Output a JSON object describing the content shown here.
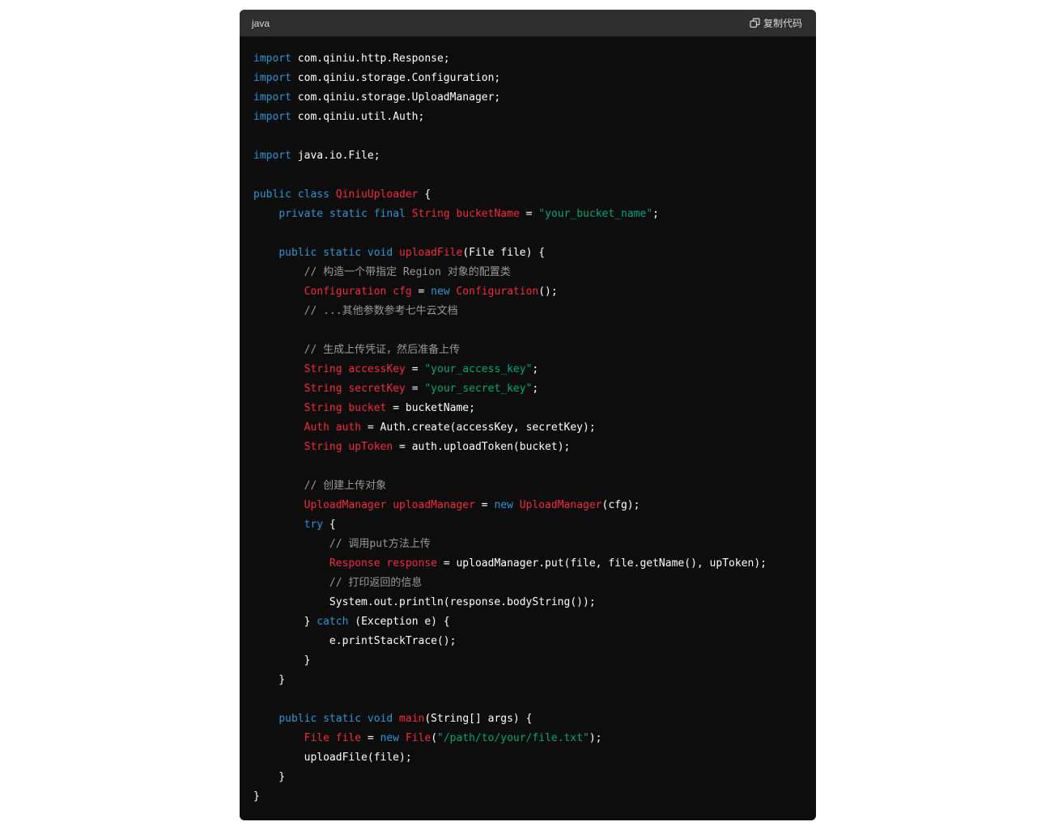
{
  "header": {
    "language": "java",
    "copy_label": "复制代码",
    "copy_icon": "copy-icon"
  },
  "colors": {
    "background": "#0d0d0d",
    "header_background": "#2f2f2f",
    "keyword": "#2e95d3",
    "type": "#f22c3d",
    "string": "#00a67d",
    "comment": "#9a9a9a",
    "plain": "#ffffff"
  },
  "code_lines": [
    [
      {
        "t": "kw",
        "v": "import"
      },
      {
        "t": "plain",
        "v": " com.qiniu.http.Response;"
      }
    ],
    [
      {
        "t": "kw",
        "v": "import"
      },
      {
        "t": "plain",
        "v": " com.qiniu.storage.Configuration;"
      }
    ],
    [
      {
        "t": "kw",
        "v": "import"
      },
      {
        "t": "plain",
        "v": " com.qiniu.storage.UploadManager;"
      }
    ],
    [
      {
        "t": "kw",
        "v": "import"
      },
      {
        "t": "plain",
        "v": " com.qiniu.util.Auth;"
      }
    ],
    [],
    [
      {
        "t": "kw",
        "v": "import"
      },
      {
        "t": "plain",
        "v": " java.io.File;"
      }
    ],
    [],
    [
      {
        "t": "kw",
        "v": "public"
      },
      {
        "t": "plain",
        "v": " "
      },
      {
        "t": "kw",
        "v": "class"
      },
      {
        "t": "plain",
        "v": " "
      },
      {
        "t": "type",
        "v": "QiniuUploader"
      },
      {
        "t": "plain",
        "v": " {"
      }
    ],
    [
      {
        "t": "plain",
        "v": "    "
      },
      {
        "t": "kw",
        "v": "private"
      },
      {
        "t": "plain",
        "v": " "
      },
      {
        "t": "kw",
        "v": "static"
      },
      {
        "t": "plain",
        "v": " "
      },
      {
        "t": "kw",
        "v": "final"
      },
      {
        "t": "plain",
        "v": " "
      },
      {
        "t": "type",
        "v": "String"
      },
      {
        "t": "plain",
        "v": " "
      },
      {
        "t": "type",
        "v": "bucketName"
      },
      {
        "t": "plain",
        "v": " = "
      },
      {
        "t": "str",
        "v": "\"your_bucket_name\""
      },
      {
        "t": "plain",
        "v": ";"
      }
    ],
    [],
    [
      {
        "t": "plain",
        "v": "    "
      },
      {
        "t": "kw",
        "v": "public"
      },
      {
        "t": "plain",
        "v": " "
      },
      {
        "t": "kw",
        "v": "static"
      },
      {
        "t": "plain",
        "v": " "
      },
      {
        "t": "kw",
        "v": "void"
      },
      {
        "t": "plain",
        "v": " "
      },
      {
        "t": "type",
        "v": "uploadFile"
      },
      {
        "t": "plain",
        "v": "(File file) {"
      }
    ],
    [
      {
        "t": "plain",
        "v": "        "
      },
      {
        "t": "cm",
        "v": "// 构造一个带指定 Region 对象的配置类"
      }
    ],
    [
      {
        "t": "plain",
        "v": "        "
      },
      {
        "t": "type",
        "v": "Configuration"
      },
      {
        "t": "plain",
        "v": " "
      },
      {
        "t": "type",
        "v": "cfg"
      },
      {
        "t": "plain",
        "v": " = "
      },
      {
        "t": "kw",
        "v": "new"
      },
      {
        "t": "plain",
        "v": " "
      },
      {
        "t": "type",
        "v": "Configuration"
      },
      {
        "t": "plain",
        "v": "();"
      }
    ],
    [
      {
        "t": "plain",
        "v": "        "
      },
      {
        "t": "cm",
        "v": "// ...其他参数参考七牛云文档"
      }
    ],
    [],
    [
      {
        "t": "plain",
        "v": "        "
      },
      {
        "t": "cm",
        "v": "// 生成上传凭证，然后准备上传"
      }
    ],
    [
      {
        "t": "plain",
        "v": "        "
      },
      {
        "t": "type",
        "v": "String"
      },
      {
        "t": "plain",
        "v": " "
      },
      {
        "t": "type",
        "v": "accessKey"
      },
      {
        "t": "plain",
        "v": " = "
      },
      {
        "t": "str",
        "v": "\"your_access_key\""
      },
      {
        "t": "plain",
        "v": ";"
      }
    ],
    [
      {
        "t": "plain",
        "v": "        "
      },
      {
        "t": "type",
        "v": "String"
      },
      {
        "t": "plain",
        "v": " "
      },
      {
        "t": "type",
        "v": "secretKey"
      },
      {
        "t": "plain",
        "v": " = "
      },
      {
        "t": "str",
        "v": "\"your_secret_key\""
      },
      {
        "t": "plain",
        "v": ";"
      }
    ],
    [
      {
        "t": "plain",
        "v": "        "
      },
      {
        "t": "type",
        "v": "String"
      },
      {
        "t": "plain",
        "v": " "
      },
      {
        "t": "type",
        "v": "bucket"
      },
      {
        "t": "plain",
        "v": " = bucketName;"
      }
    ],
    [
      {
        "t": "plain",
        "v": "        "
      },
      {
        "t": "type",
        "v": "Auth"
      },
      {
        "t": "plain",
        "v": " "
      },
      {
        "t": "type",
        "v": "auth"
      },
      {
        "t": "plain",
        "v": " = Auth.create(accessKey, secretKey);"
      }
    ],
    [
      {
        "t": "plain",
        "v": "        "
      },
      {
        "t": "type",
        "v": "String"
      },
      {
        "t": "plain",
        "v": " "
      },
      {
        "t": "type",
        "v": "upToken"
      },
      {
        "t": "plain",
        "v": " = auth.uploadToken(bucket);"
      }
    ],
    [],
    [
      {
        "t": "plain",
        "v": "        "
      },
      {
        "t": "cm",
        "v": "// 创建上传对象"
      }
    ],
    [
      {
        "t": "plain",
        "v": "        "
      },
      {
        "t": "type",
        "v": "UploadManager"
      },
      {
        "t": "plain",
        "v": " "
      },
      {
        "t": "type",
        "v": "uploadManager"
      },
      {
        "t": "plain",
        "v": " = "
      },
      {
        "t": "kw",
        "v": "new"
      },
      {
        "t": "plain",
        "v": " "
      },
      {
        "t": "type",
        "v": "UploadManager"
      },
      {
        "t": "plain",
        "v": "(cfg);"
      }
    ],
    [
      {
        "t": "plain",
        "v": "        "
      },
      {
        "t": "kw",
        "v": "try"
      },
      {
        "t": "plain",
        "v": " {"
      }
    ],
    [
      {
        "t": "plain",
        "v": "            "
      },
      {
        "t": "cm",
        "v": "// 调用put方法上传"
      }
    ],
    [
      {
        "t": "plain",
        "v": "            "
      },
      {
        "t": "type",
        "v": "Response"
      },
      {
        "t": "plain",
        "v": " "
      },
      {
        "t": "type",
        "v": "response"
      },
      {
        "t": "plain",
        "v": " = uploadManager.put(file, file.getName(), upToken);"
      }
    ],
    [
      {
        "t": "plain",
        "v": "            "
      },
      {
        "t": "cm",
        "v": "// 打印返回的信息"
      }
    ],
    [
      {
        "t": "plain",
        "v": "            System.out.println(response.bodyString());"
      }
    ],
    [
      {
        "t": "plain",
        "v": "        } "
      },
      {
        "t": "kw",
        "v": "catch"
      },
      {
        "t": "plain",
        "v": " (Exception e) {"
      }
    ],
    [
      {
        "t": "plain",
        "v": "            e.printStackTrace();"
      }
    ],
    [
      {
        "t": "plain",
        "v": "        }"
      }
    ],
    [
      {
        "t": "plain",
        "v": "    }"
      }
    ],
    [],
    [
      {
        "t": "plain",
        "v": "    "
      },
      {
        "t": "kw",
        "v": "public"
      },
      {
        "t": "plain",
        "v": " "
      },
      {
        "t": "kw",
        "v": "static"
      },
      {
        "t": "plain",
        "v": " "
      },
      {
        "t": "kw",
        "v": "void"
      },
      {
        "t": "plain",
        "v": " "
      },
      {
        "t": "type",
        "v": "main"
      },
      {
        "t": "plain",
        "v": "(String[] args) {"
      }
    ],
    [
      {
        "t": "plain",
        "v": "        "
      },
      {
        "t": "type",
        "v": "File"
      },
      {
        "t": "plain",
        "v": " "
      },
      {
        "t": "type",
        "v": "file"
      },
      {
        "t": "plain",
        "v": " = "
      },
      {
        "t": "kw",
        "v": "new"
      },
      {
        "t": "plain",
        "v": " "
      },
      {
        "t": "type",
        "v": "File"
      },
      {
        "t": "plain",
        "v": "("
      },
      {
        "t": "str",
        "v": "\"/path/to/your/file.txt\""
      },
      {
        "t": "plain",
        "v": ");"
      }
    ],
    [
      {
        "t": "plain",
        "v": "        uploadFile(file);"
      }
    ],
    [
      {
        "t": "plain",
        "v": "    }"
      }
    ],
    [
      {
        "t": "plain",
        "v": "}"
      }
    ]
  ]
}
